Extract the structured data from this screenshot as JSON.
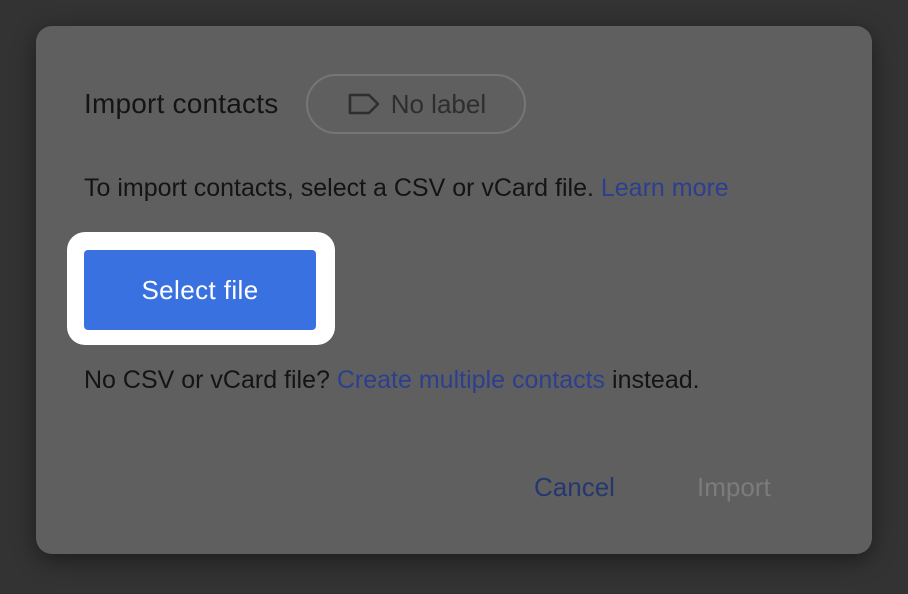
{
  "dialog": {
    "title": "Import contacts",
    "label_chip": {
      "icon": "label-outline-icon",
      "text": "No label"
    },
    "instructions": {
      "text": "To import contacts, select a CSV or vCard file. ",
      "link": "Learn more"
    },
    "select_file_label": "Select file",
    "alternative": {
      "prefix": "No CSV or vCard file? ",
      "link": "Create multiple contacts",
      "suffix": " instead."
    },
    "actions": {
      "cancel": "Cancel",
      "import": "Import"
    }
  },
  "colors": {
    "backdrop": "#333333",
    "dialog_bg": "#5f5f5f",
    "primary": "#3a71e1",
    "link": "#2c3f8f",
    "highlight": "#ffffff"
  }
}
